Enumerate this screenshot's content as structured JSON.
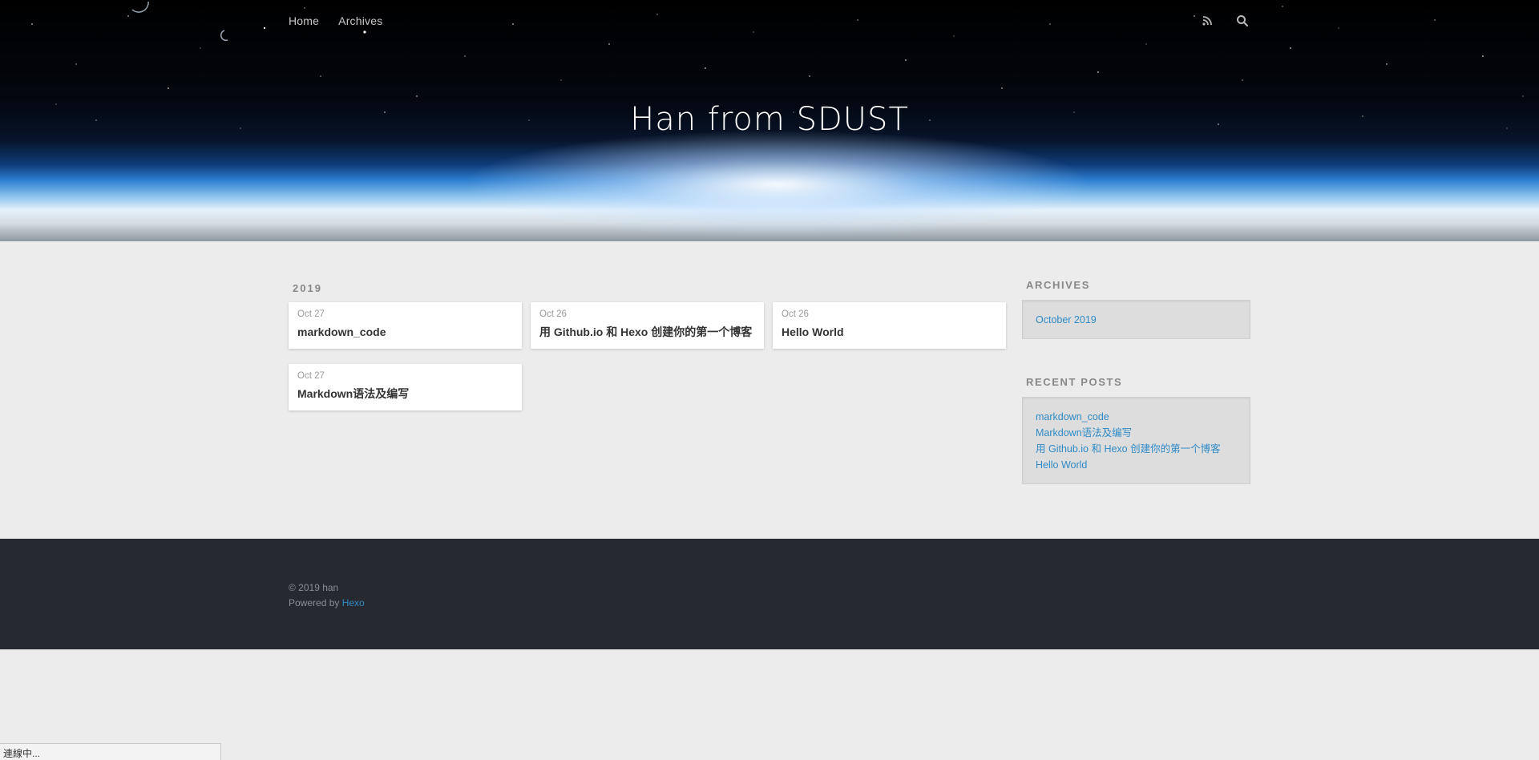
{
  "header": {
    "nav": [
      "Home",
      "Archives"
    ],
    "title": "Han from SDUST",
    "icons": [
      "rss-icon",
      "search-icon"
    ]
  },
  "main": {
    "year": "2019",
    "posts": [
      {
        "date": "Oct 27",
        "title": "markdown_code"
      },
      {
        "date": "Oct 26",
        "title": "用 Github.io 和 Hexo 创建你的第一个博客"
      },
      {
        "date": "Oct 26",
        "title": "Hello World"
      },
      {
        "date": "Oct 27",
        "title": "Markdown语法及编写"
      }
    ]
  },
  "sidebar": {
    "archives_title": "ARCHIVES",
    "archives": [
      "October 2019"
    ],
    "recent_title": "RECENT POSTS",
    "recent": [
      "markdown_code",
      "Markdown语法及编写",
      "用 Github.io 和 Hexo 创建你的第一个博客",
      "Hello World"
    ]
  },
  "footer": {
    "copyright": "© 2019 han",
    "powered_by": "Powered by",
    "hexo_link": "Hexo"
  },
  "status": {
    "text": "連線中..."
  },
  "colors": {
    "link": "#2f8bc7",
    "footer_bg": "#262a30",
    "page_bg": "#ececec"
  }
}
